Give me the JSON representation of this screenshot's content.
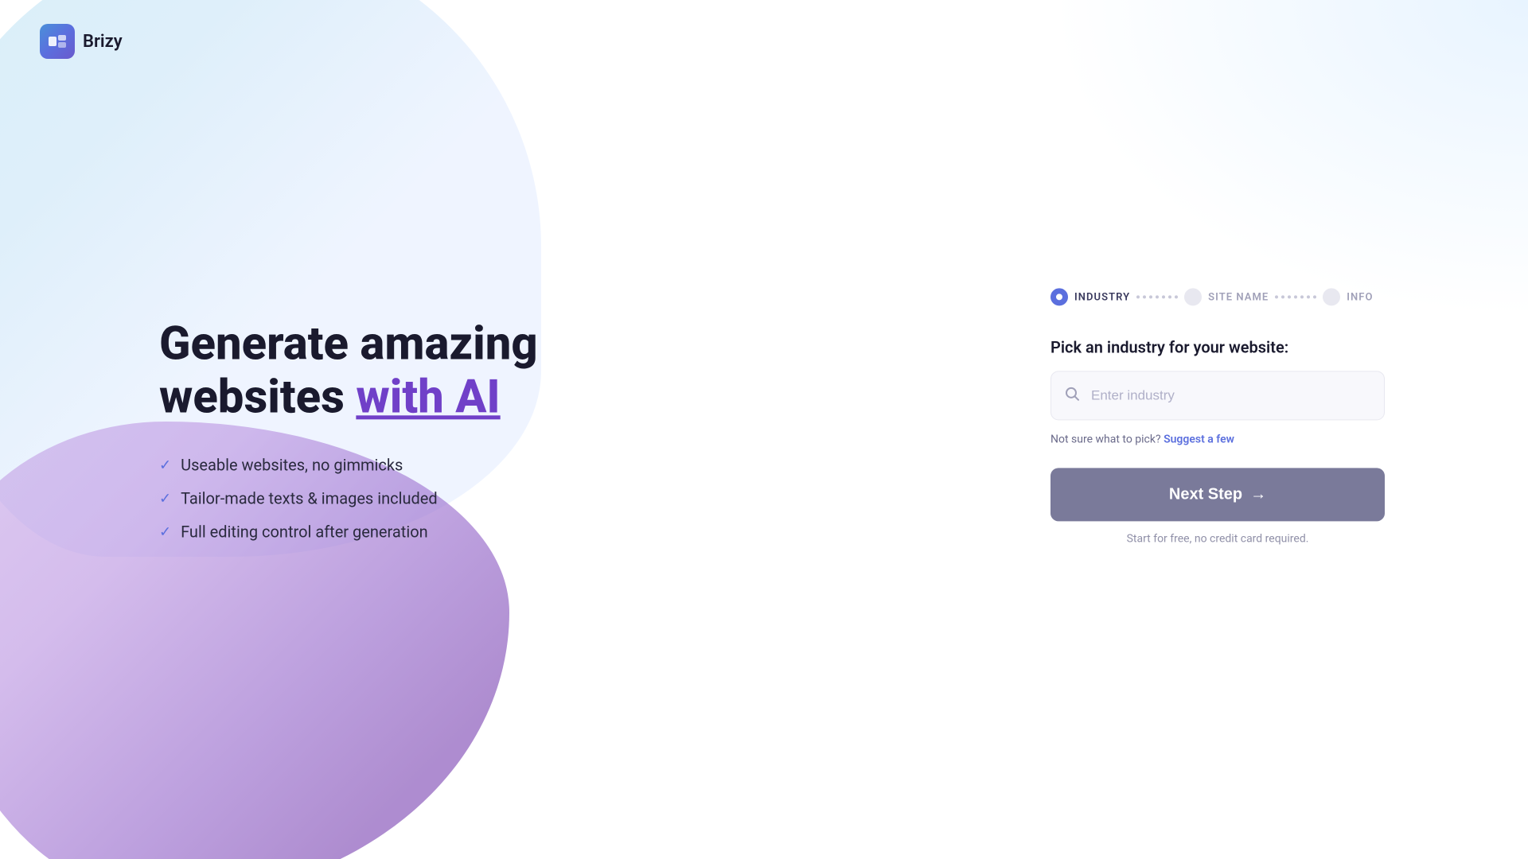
{
  "brand": {
    "logo_text": "Brizy",
    "logo_icon": "ai"
  },
  "hero": {
    "heading_line1": "Generate amazing",
    "heading_line2_plain": "websites ",
    "heading_line2_highlight": "with AI",
    "features": [
      {
        "text": "Useable websites, no gimmicks"
      },
      {
        "text": "Tailor-made texts & images included"
      },
      {
        "text": "Full editing control after generation"
      }
    ]
  },
  "steps": {
    "step1": {
      "label": "INDUSTRY",
      "active": true
    },
    "step2": {
      "label": "SITE NAME",
      "active": false
    },
    "step3": {
      "label": "INFO",
      "active": false
    }
  },
  "form": {
    "section_label": "Pick an industry for your website:",
    "input_placeholder": "Enter industry",
    "suggest_prefix": "Not sure what to pick?",
    "suggest_link": "Suggest a few",
    "next_step_label": "Next Step",
    "next_step_arrow": "→",
    "free_text": "Start for free, no credit card required."
  }
}
